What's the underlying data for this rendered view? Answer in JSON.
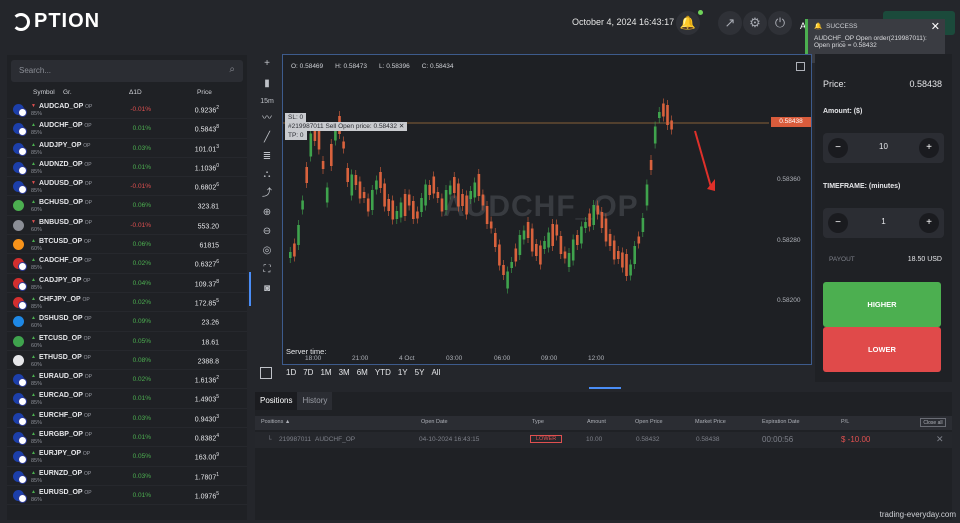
{
  "header": {
    "logo_text": "PTION",
    "datetime": "October 4, 2024 16:43:17",
    "account_initial": "A"
  },
  "toast": {
    "title": "SUCCESS",
    "message_line1": "AUDCHF_OP Open order(219987011):",
    "message_line2": "Open price = 0.58432",
    "close": "✕"
  },
  "search": {
    "placeholder": "Search..."
  },
  "asset_table": {
    "headers": {
      "symbol": "Symbol",
      "group": "Gr.",
      "change": "Δ1D",
      "price": "Price"
    },
    "rows": [
      {
        "symbol": "AUDCAD_OP",
        "tag": "OP",
        "pct": "85%",
        "change": "-0.01%",
        "dir": "down",
        "price": "0.9236",
        "sup": "2",
        "c1": "#1c3faa",
        "c2": "#d32f2f"
      },
      {
        "symbol": "AUDCHF_OP",
        "tag": "OP",
        "pct": "85%",
        "change": "0.01%",
        "dir": "up",
        "price": "0.5843",
        "sup": "8",
        "c1": "#1c3faa",
        "c2": "#d32f2f"
      },
      {
        "symbol": "AUDJPY_OP",
        "tag": "OP",
        "pct": "85%",
        "change": "0.03%",
        "dir": "up",
        "price": "101.01",
        "sup": "3",
        "c1": "#1c3faa",
        "c2": "#ffffff"
      },
      {
        "symbol": "AUDNZD_OP",
        "tag": "OP",
        "pct": "85%",
        "change": "0.01%",
        "dir": "up",
        "price": "1.1036",
        "sup": "0",
        "c1": "#1c3faa",
        "c2": "#1c3faa"
      },
      {
        "symbol": "AUDUSD_OP",
        "tag": "OP",
        "pct": "85%",
        "change": "-0.01%",
        "dir": "down",
        "price": "0.6802",
        "sup": "6",
        "c1": "#1c3faa",
        "c2": "#1c3faa"
      },
      {
        "symbol": "BCHUSD_OP",
        "tag": "OP",
        "pct": "60%",
        "change": "0.06%",
        "dir": "up",
        "price": "323.81",
        "sup": "",
        "c1": "#4caf50",
        "c2": ""
      },
      {
        "symbol": "BNBUSD_OP",
        "tag": "OP",
        "pct": "60%",
        "change": "-0.01%",
        "dir": "down",
        "price": "553.20",
        "sup": "",
        "c1": "#8b8e96",
        "c2": ""
      },
      {
        "symbol": "BTCUSD_OP",
        "tag": "OP",
        "pct": "60%",
        "change": "0.06%",
        "dir": "up",
        "price": "61815",
        "sup": "",
        "c1": "#f7931a",
        "c2": ""
      },
      {
        "symbol": "CADCHF_OP",
        "tag": "OP",
        "pct": "85%",
        "change": "0.02%",
        "dir": "up",
        "price": "0.6327",
        "sup": "6",
        "c1": "#d32f2f",
        "c2": "#d32f2f"
      },
      {
        "symbol": "CADJPY_OP",
        "tag": "OP",
        "pct": "85%",
        "change": "0.04%",
        "dir": "up",
        "price": "109.37",
        "sup": "8",
        "c1": "#d32f2f",
        "c2": "#ffffff"
      },
      {
        "symbol": "CHFJPY_OP",
        "tag": "OP",
        "pct": "85%",
        "change": "0.02%",
        "dir": "up",
        "price": "172.85",
        "sup": "5",
        "c1": "#d32f2f",
        "c2": "#ffffff"
      },
      {
        "symbol": "DSHUSD_OP",
        "tag": "OP",
        "pct": "60%",
        "change": "0.09%",
        "dir": "up",
        "price": "23.26",
        "sup": "",
        "c1": "#1e88e5",
        "c2": ""
      },
      {
        "symbol": "ETCUSD_OP",
        "tag": "OP",
        "pct": "60%",
        "change": "0.05%",
        "dir": "up",
        "price": "18.61",
        "sup": "",
        "c1": "#3fa34d",
        "c2": ""
      },
      {
        "symbol": "ETHUSD_OP",
        "tag": "OP",
        "pct": "60%",
        "change": "0.08%",
        "dir": "up",
        "price": "2388.8",
        "sup": "",
        "c1": "#e6e7ea",
        "c2": ""
      },
      {
        "symbol": "EURAUD_OP",
        "tag": "OP",
        "pct": "85%",
        "change": "0.02%",
        "dir": "up",
        "price": "1.6136",
        "sup": "2",
        "c1": "#1c3faa",
        "c2": "#1c3faa"
      },
      {
        "symbol": "EURCAD_OP",
        "tag": "OP",
        "pct": "85%",
        "change": "0.01%",
        "dir": "up",
        "price": "1.4903",
        "sup": "5",
        "c1": "#1c3faa",
        "c2": "#d32f2f"
      },
      {
        "symbol": "EURCHF_OP",
        "tag": "OP",
        "pct": "85%",
        "change": "0.03%",
        "dir": "up",
        "price": "0.9430",
        "sup": "3",
        "c1": "#1c3faa",
        "c2": "#d32f2f"
      },
      {
        "symbol": "EURGBP_OP",
        "tag": "OP",
        "pct": "85%",
        "change": "0.01%",
        "dir": "up",
        "price": "0.8382",
        "sup": "4",
        "c1": "#1c3faa",
        "c2": "#c62828"
      },
      {
        "symbol": "EURJPY_OP",
        "tag": "OP",
        "pct": "85%",
        "change": "0.05%",
        "dir": "up",
        "price": "163.00",
        "sup": "9",
        "c1": "#1c3faa",
        "c2": "#ffffff"
      },
      {
        "symbol": "EURNZD_OP",
        "tag": "OP",
        "pct": "85%",
        "change": "0.03%",
        "dir": "up",
        "price": "1.7807",
        "sup": "1",
        "c1": "#1c3faa",
        "c2": "#1c3faa"
      },
      {
        "symbol": "EURUSD_OP",
        "tag": "OP",
        "pct": "86%",
        "change": "0.01%",
        "dir": "up",
        "price": "1.0976",
        "sup": "5",
        "c1": "#1c3faa",
        "c2": "#1c3faa"
      }
    ]
  },
  "chart": {
    "ohlc": {
      "o": "O: 0.58469",
      "h": "H: 0.58473",
      "l": "L: 0.58396",
      "c": "C: 0.58434"
    },
    "watermark": "AUDCHF_OP",
    "order_labels": {
      "sl": "SL: 0",
      "order": "#219987011  Sell  Open price: 0.58432  ✕",
      "tp": "TP: 0"
    },
    "current_price_tag": "0.58438",
    "y_ticks": [
      "0.58360",
      "0.58280",
      "0.58200"
    ],
    "x_ticks": [
      "18:00",
      "21:00",
      "4 Oct",
      "03:00",
      "06:00",
      "09:00",
      "12:00"
    ],
    "server_time": "Server time:",
    "timeframe": "15m",
    "periods": [
      "1D",
      "7D",
      "1M",
      "3M",
      "6M",
      "YTD",
      "1Y",
      "5Y",
      "All"
    ]
  },
  "trade_panel": {
    "price_label": "Price:",
    "price_value": "0.58438",
    "amount_label": "Amount: ($)",
    "amount_value": "10",
    "timeframe_label": "TIMEFRAME: (minutes)",
    "timeframe_value": "1",
    "payout_label": "PAYOUT",
    "payout_value": "18.50 USD",
    "higher_label": "HIGHER",
    "lower_label": "LOWER",
    "minus": "−",
    "plus": "+"
  },
  "positions": {
    "tab_positions": "Positions",
    "tab_history": "History",
    "headers": {
      "positions": "Positions ▲",
      "open_date": "Open Date",
      "type": "Type",
      "amount": "Amount",
      "open_price": "Open Price",
      "market_price": "Market Price",
      "expiration": "Expiration Date",
      "pl": "P/L",
      "close_all": "Close all"
    },
    "row": {
      "id": "219987011",
      "symbol": "AUDCHF_OP",
      "open_date": "04-10-2024 16:43:15",
      "type": "LOWER",
      "amount": "10.00",
      "open_price": "0.58432",
      "market_price": "0.58438",
      "expiration": "00:00:56",
      "pl": "$ -10.00",
      "close": "✕"
    }
  },
  "footer_watermark": "trading-everyday.com",
  "colors": {
    "higher": "#4caf50",
    "lower": "#e04a4a",
    "up_candle": "#3fa34d",
    "down_candle": "#d9623d",
    "toast_accent": "#4caf50"
  }
}
